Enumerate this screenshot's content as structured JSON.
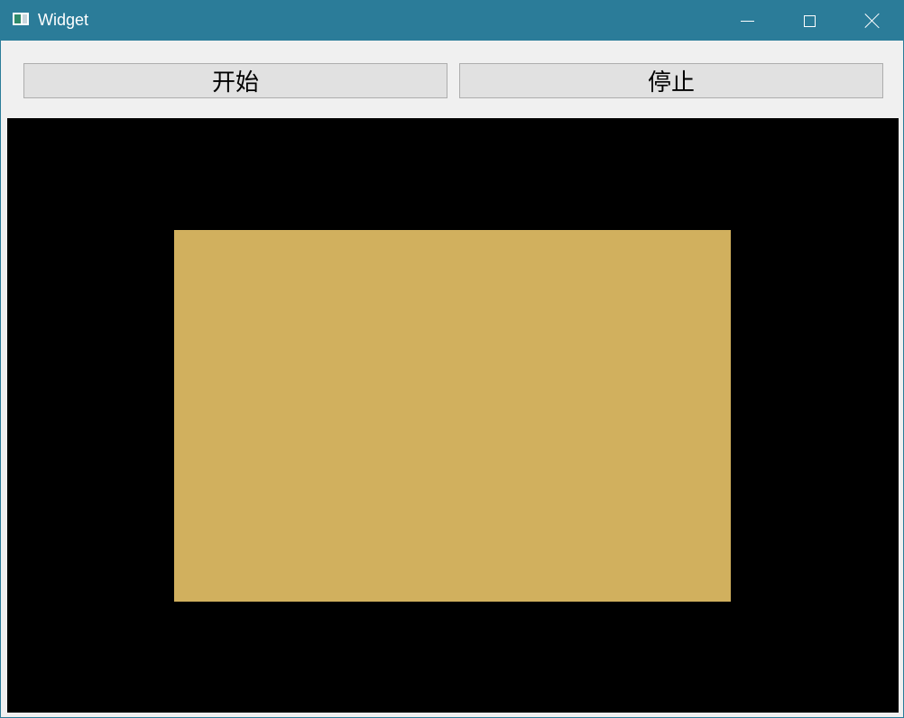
{
  "window": {
    "title": "Widget",
    "titlebar_color": "#2b7c99",
    "controls": {
      "minimize_icon": "minimize-icon",
      "maximize_icon": "maximize-icon",
      "close_icon": "close-icon"
    }
  },
  "toolbar": {
    "start_label": "开始",
    "stop_label": "停止"
  },
  "canvas": {
    "background_color": "#000000",
    "rect_color": "#d1b05e"
  }
}
